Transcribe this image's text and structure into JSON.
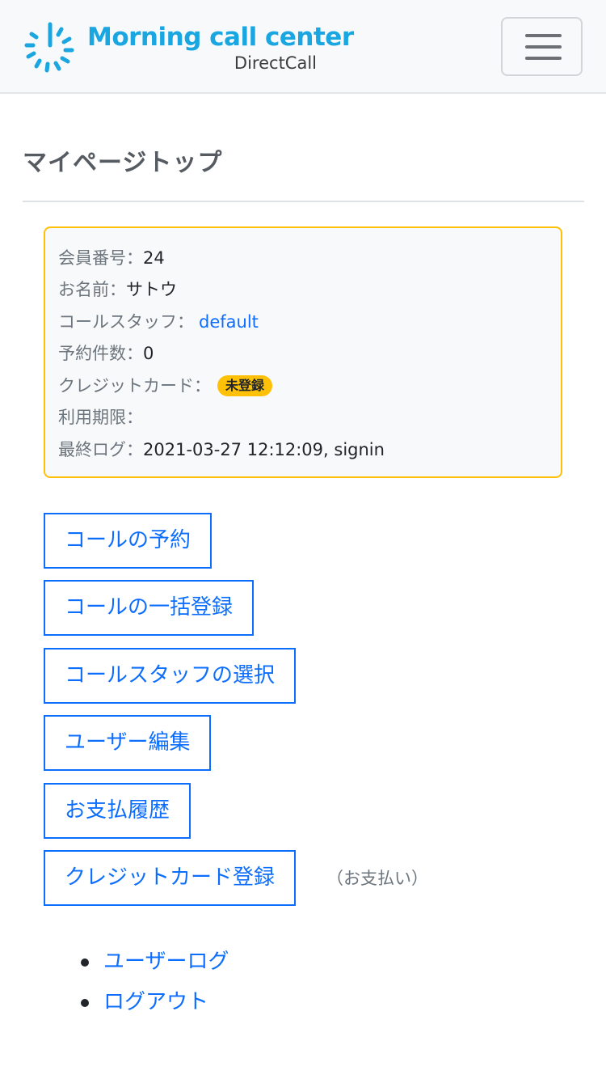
{
  "header": {
    "logo_title": "Morning call center",
    "logo_subtitle": "DirectCall",
    "brand_color": "#1aa6e0",
    "menu_icon": "hamburger-menu-icon"
  },
  "page": {
    "title": "マイページトップ"
  },
  "account": {
    "member_no_label": "会員番号：",
    "member_no": "24",
    "name_label": "お名前：",
    "name": "サトウ",
    "staff_label": "コールスタッフ：",
    "staff": "default",
    "reservations_label": "予約件数：",
    "reservations": "0",
    "card_label": "クレジットカード：",
    "card_status": "未登録",
    "expiry_label": "利用期限：",
    "expiry": "",
    "last_log_label": "最終ログ：",
    "last_log": "2021-03-27 12:12:09, signin"
  },
  "actions": {
    "reserve": "コールの予約",
    "bulk": "コールの一括登録",
    "staff_select": "コールスタッフの選択",
    "user_edit": "ユーザー編集",
    "payment_history": "お支払履歴",
    "card_register": "クレジットカード登録",
    "card_register_note": "（お支払い）"
  },
  "links": {
    "user_log": "ユーザーログ",
    "logout": "ログアウト"
  },
  "colors": {
    "primary": "#0d6efd",
    "warning": "#ffc107"
  }
}
